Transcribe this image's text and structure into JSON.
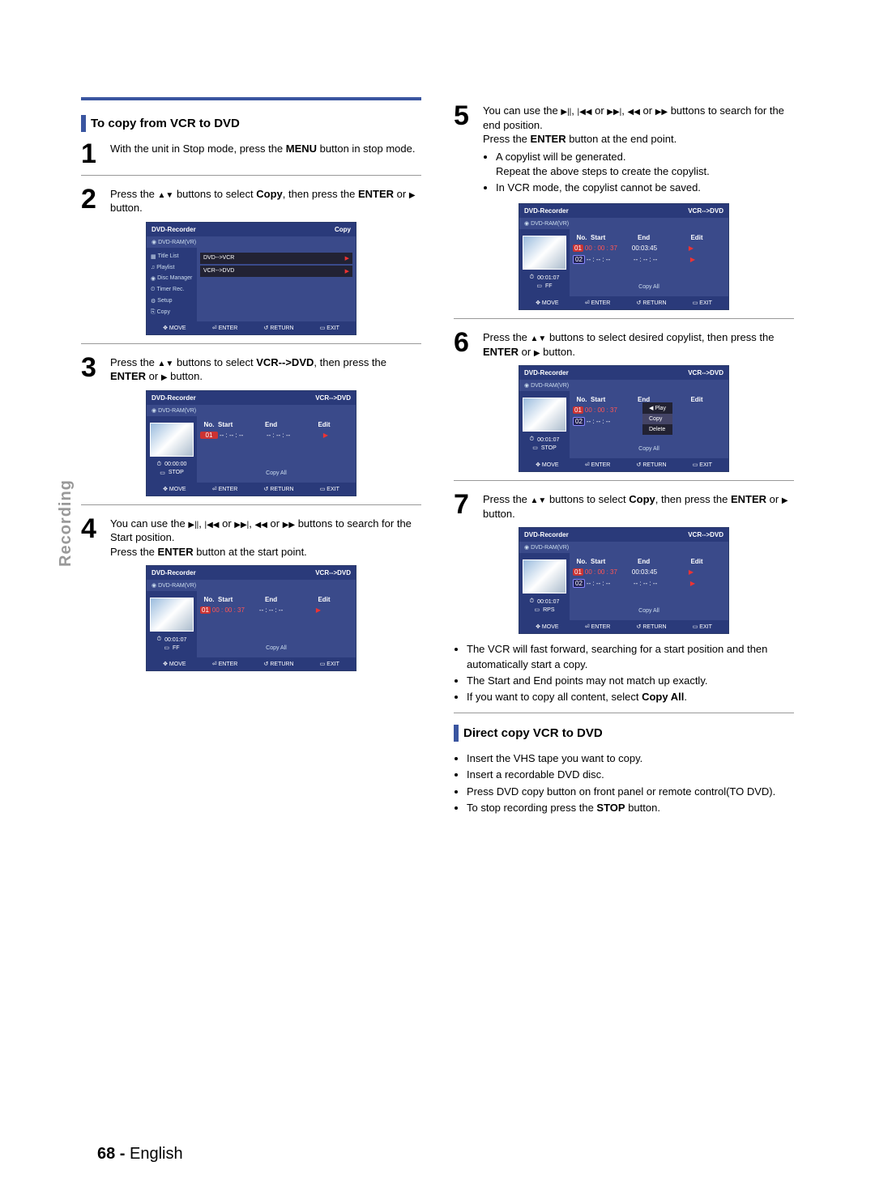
{
  "sideLabel": "Recording",
  "sec1Title": "To copy from VCR to DVD",
  "sec2Title": "Direct copy VCR to DVD",
  "steps": {
    "s1": {
      "num": "1",
      "text": "With the unit in Stop mode, press the MENU button in stop mode."
    },
    "s2": {
      "num": "2",
      "pre": "Press the ",
      "mid": " buttons to select ",
      "tgt": "Copy",
      "post": ", then press the ",
      "btn": "ENTER",
      "or": " or ",
      "end": " button."
    },
    "s3": {
      "num": "3",
      "pre": "Press the ",
      "mid": " buttons to select ",
      "tgt": "VCR-->DVD",
      "post": ", then press the ",
      "btn": "ENTER",
      "or": " or ",
      "end": " button."
    },
    "s4": {
      "num": "4",
      "pre": "You can use the ",
      "mid": " buttons to search for the Start position.",
      "line2a": "Press the ",
      "line2b": " button at the start point.",
      "btn": "ENTER"
    },
    "s5": {
      "num": "5",
      "pre": "You can use the ",
      "mid": " buttons to search for the end position.",
      "line2a": "Press the ",
      "line2b": " button at the end point.",
      "btn": "ENTER",
      "b1": "A copylist will be generated.",
      "b1b": "Repeat the above steps to create the copylist.",
      "b2": "In VCR mode, the copylist cannot be saved."
    },
    "s6": {
      "num": "6",
      "pre": "Press the ",
      "mid": " buttons to select desired copylist, then press the ",
      "btn": "ENTER",
      "or": " or ",
      "end": " button."
    },
    "s7": {
      "num": "7",
      "pre": "Press the ",
      "mid": " buttons to select ",
      "tgt": "Copy",
      "post": ", then press the ",
      "btn": "ENTER",
      "or": " or ",
      "end": " button."
    }
  },
  "afterSteps": {
    "b1": "The VCR will fast forward, searching for a start position and then automatically start a copy.",
    "b2": "The Start and End points may not match up exactly.",
    "b3a": "If you want to copy all content, select ",
    "b3b": "Copy All",
    "b3c": "."
  },
  "direct": {
    "b1": "Insert the VHS tape you want to copy.",
    "b2": "Insert a recordable DVD disc.",
    "b3": "Press DVD copy button on front panel or remote control(TO DVD).",
    "b4a": "To stop recording press the ",
    "b4b": "STOP",
    "b4c": " button."
  },
  "osd": {
    "titleRec": "DVD-Recorder",
    "titleCopy": "Copy",
    "titleVcrDvd": "VCR-->DVD",
    "sub": "DVD-RAM(VR)",
    "side": {
      "title": "Title List",
      "playlist": "Playlist",
      "disc": "Disc Manager",
      "timer": "Timer Rec.",
      "setup": "Setup",
      "copy": "Copy"
    },
    "menu": {
      "dvdvcr": "DVD-->VCR",
      "vcrdvd": "VCR-->DVD"
    },
    "th": {
      "no": "No.",
      "start": "Start",
      "end": "End",
      "edit": "Edit"
    },
    "times": {
      "r1s": "01 00 : 00 : 37",
      "r1e": "00:03:45",
      "r2s": "-- : -- : --",
      "r2e": "-- : -- : --",
      "zero": "00:00:00",
      "t107": "00:01:07"
    },
    "thumbStatus": {
      "stop": "STOP",
      "ff": "FF",
      "rps": "RPS"
    },
    "popup": {
      "play": "Play",
      "copy": "Copy",
      "del": "Delete"
    },
    "copyAll": "Copy All",
    "foot": {
      "move": "MOVE",
      "enter": "ENTER",
      "ret": "RETURN",
      "exit": "EXIT"
    }
  },
  "footer": {
    "page": "68 -",
    "lang": "English"
  },
  "chart_data": null
}
